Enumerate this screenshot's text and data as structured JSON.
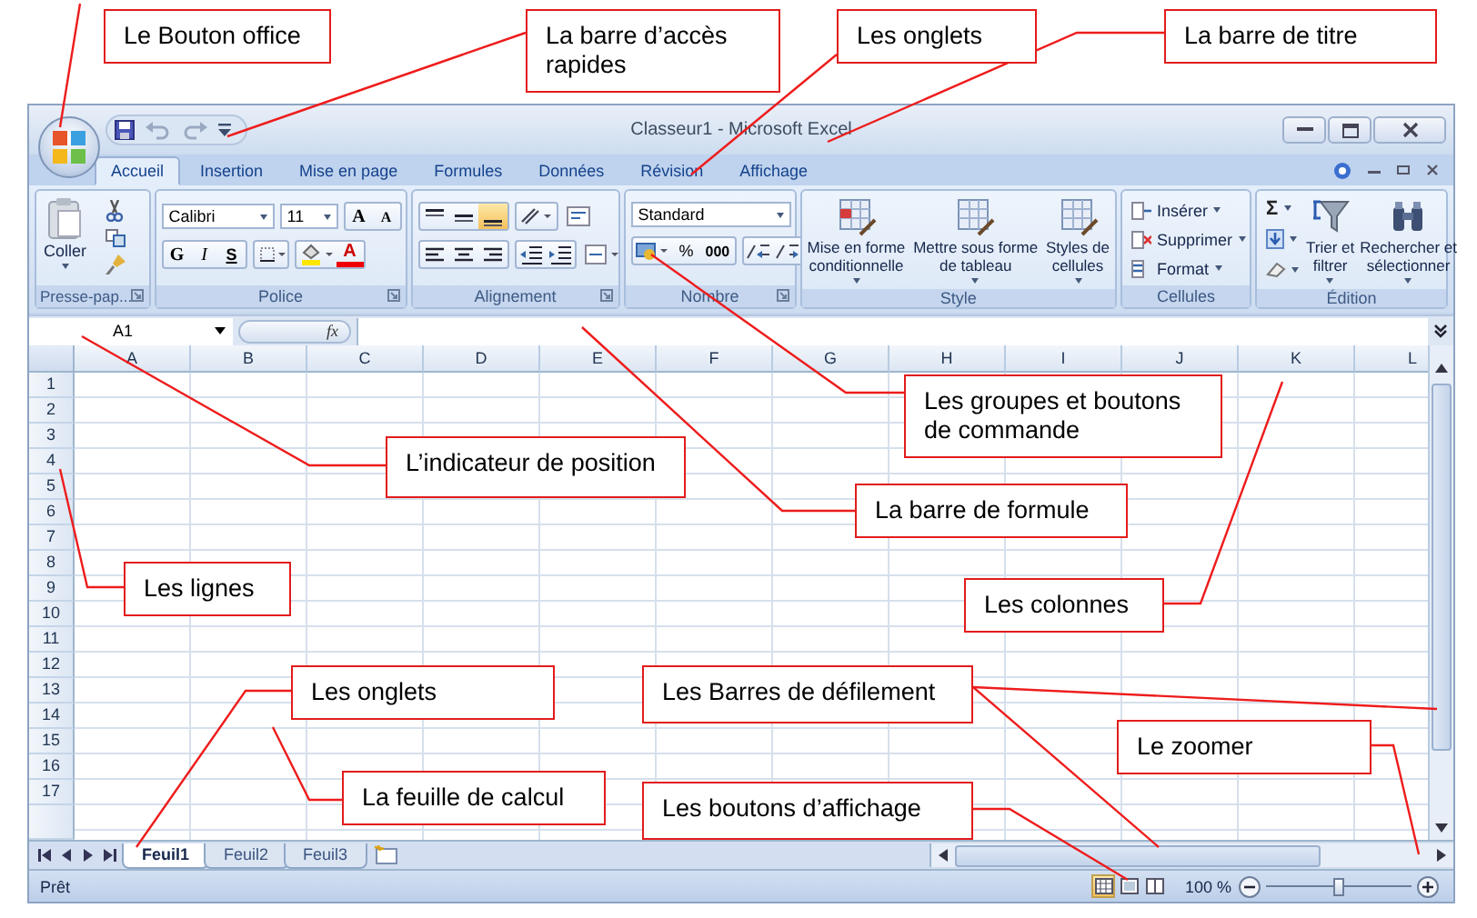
{
  "window": {
    "title": "Classeur1 - Microsoft Excel"
  },
  "tabs": [
    {
      "label": "Accueil",
      "selected": true
    },
    {
      "label": "Insertion",
      "selected": false
    },
    {
      "label": "Mise en page",
      "selected": false
    },
    {
      "label": "Formules",
      "selected": false
    },
    {
      "label": "Données",
      "selected": false
    },
    {
      "label": "Révision",
      "selected": false
    },
    {
      "label": "Affichage",
      "selected": false
    }
  ],
  "clipboard": {
    "label": "Presse-pap...",
    "paste": "Coller"
  },
  "font": {
    "label": "Police",
    "font_name": "Calibri",
    "font_size": "11",
    "grow": "A",
    "shrink": "A",
    "bold": "G",
    "italic": "I",
    "underline": "S",
    "font_color": "A"
  },
  "alignment": {
    "label": "Alignement",
    "vertical_align": [
      {
        "selected": false
      },
      {
        "selected": false
      },
      {
        "selected": true
      }
    ]
  },
  "number": {
    "label": "Nombre",
    "format": "Standard",
    "percent": "%",
    "thousands": "000"
  },
  "style": {
    "label": "Style",
    "buttons": [
      [
        "Mise en forme",
        "conditionnelle"
      ],
      [
        "Mettre sous forme",
        "de tableau"
      ],
      [
        "Styles de",
        "cellules"
      ]
    ]
  },
  "cells": {
    "label": "Cellules",
    "buttons": [
      "Insérer",
      "Supprimer",
      "Format"
    ]
  },
  "editing": {
    "label": "Édition",
    "sum": "Σ",
    "buttons": [
      [
        "Trier et",
        "filtrer"
      ],
      [
        "Rechercher et",
        "sélectionner"
      ]
    ]
  },
  "formula_bar": {
    "name_box": "A1",
    "fx": "fx"
  },
  "columns": [
    "A",
    "B",
    "C",
    "D",
    "E",
    "F",
    "G",
    "H",
    "I",
    "J",
    "K",
    "L"
  ],
  "rows": [
    "1",
    "2",
    "3",
    "4",
    "5",
    "6",
    "7",
    "8",
    "9",
    "10",
    "11",
    "12",
    "13",
    "14",
    "15",
    "16",
    "17"
  ],
  "sheet_tabs": [
    {
      "label": "Feuil1",
      "selected": true
    },
    {
      "label": "Feuil2",
      "selected": false
    },
    {
      "label": "Feuil3",
      "selected": false
    }
  ],
  "status_bar": {
    "status": "Prêt",
    "views": [
      {
        "selected": true
      },
      {
        "selected": false
      },
      {
        "selected": false
      }
    ],
    "zoom_label": "100 %",
    "zoom": {
      "level": 0.5
    }
  },
  "callouts": [
    {
      "text": "Le Bouton office"
    },
    {
      "text": "La barre d’accès rapides"
    },
    {
      "text": "Les onglets"
    },
    {
      "text": "La barre de titre"
    },
    {
      "text": "Les groupes et boutons de commande"
    },
    {
      "text": "L’indicateur de position"
    },
    {
      "text": "La barre de formule"
    },
    {
      "text": "Les lignes"
    },
    {
      "text": "Les colonnes"
    },
    {
      "text": "Les onglets"
    },
    {
      "text": "La feuille de calcul"
    },
    {
      "text": "Les Barres de défilement"
    },
    {
      "text": "Le zoomer"
    },
    {
      "text": "Les boutons d’affichage"
    }
  ]
}
